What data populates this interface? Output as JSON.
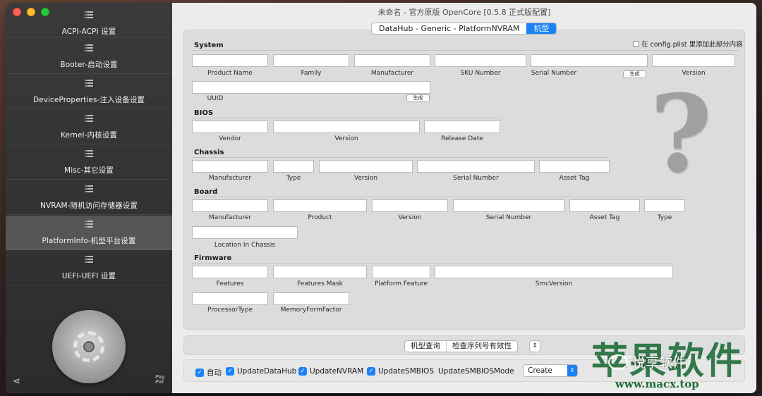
{
  "window": {
    "title": "未命名 - 官方原版 OpenCore [0.5.8 正式版配置]"
  },
  "sidebar": {
    "items": [
      {
        "label": "ACPI-ACPI 设置",
        "active": false
      },
      {
        "label": "Booter-启动设置",
        "active": false
      },
      {
        "label": "DeviceProperties-注入设备设置",
        "active": false
      },
      {
        "label": "Kernel-内核设置",
        "active": false
      },
      {
        "label": "Misc-其它设置",
        "active": false
      },
      {
        "label": "NVRAM-随机访问存储器设置",
        "active": false
      },
      {
        "label": "PlatformInfo-机型平台设置",
        "active": true
      },
      {
        "label": "UEFI-UEFI 设置",
        "active": false
      }
    ],
    "paypal": "Pay Pal"
  },
  "tabs": {
    "main": "DataHub - Generic - PlatformNVRAM",
    "model": "机型"
  },
  "add_to_config": "在 config.plist 里添加此部分内容",
  "sections": {
    "system": {
      "title": "System",
      "fields": [
        "Product Name",
        "Family",
        "Manufacturer",
        "SKU Number",
        "Serial Number",
        "Version"
      ],
      "uuid": "UUID",
      "generate": "生成"
    },
    "bios": {
      "title": "BIOS",
      "fields": [
        "Vendor",
        "Version",
        "Release Date"
      ]
    },
    "chassis": {
      "title": "Chassis",
      "fields": [
        "Manufacturer",
        "Type",
        "Version",
        "Serial Number",
        "Asset Tag"
      ]
    },
    "board": {
      "title": "Board",
      "fields": [
        "Manufacturer",
        "Product",
        "Version",
        "Serial Number",
        "Asset Tag",
        "Type"
      ],
      "location": "Location In Chassis"
    },
    "firmware": {
      "title": "Firmware",
      "fields": [
        "Features",
        "Features Mask",
        "Platform Feature",
        "SmcVersion"
      ],
      "fields2": [
        "ProcessorType",
        "MemoryFormFactor"
      ]
    }
  },
  "actions": {
    "model_lookup": "机型查询",
    "check_serial": "检查序列号有效性"
  },
  "options": {
    "auto": "自动",
    "update_datahub": "UpdateDataHub",
    "update_nvram": "UpdateNVRAM",
    "update_smbios": "UpdateSMBIOS",
    "smbios_mode_label": "UpdateSMBIOSMode",
    "smbios_mode_value": "Create"
  },
  "watermark": {
    "site": "苹果软件",
    "account": "悦享软件",
    "url": "www.macx.top"
  },
  "colors": {
    "accent": "#1a82f5",
    "sidebar": "#2f2f2f",
    "sidebar_active": "#555555"
  }
}
